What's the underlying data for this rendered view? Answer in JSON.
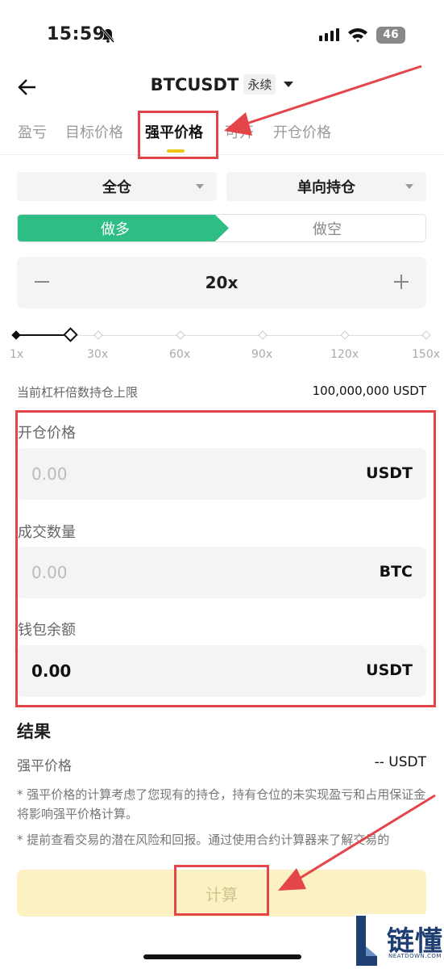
{
  "status_bar": {
    "time": "15:59",
    "battery": "46"
  },
  "header": {
    "title": "BTCUSDT",
    "badge": "永续"
  },
  "tabs": [
    {
      "label": "盈亏"
    },
    {
      "label": "目标价格"
    },
    {
      "label": "强平价格"
    },
    {
      "label": "可开"
    },
    {
      "label": "开仓价格"
    }
  ],
  "margin_mode": {
    "value": "全仓"
  },
  "position_mode": {
    "value": "单向持仓"
  },
  "direction": {
    "long": "做多",
    "short": "做空"
  },
  "leverage": {
    "value": "20x"
  },
  "slider": {
    "selected_fraction": 0.133,
    "ticks": [
      "1x",
      "30x",
      "60x",
      "90x",
      "120x",
      "150x"
    ]
  },
  "position_limit": {
    "label": "当前杠杆倍数持仓上限",
    "value": "100,000,000 USDT"
  },
  "fields": {
    "entry_price": {
      "label": "开仓价格",
      "value": "0.00",
      "unit": "USDT"
    },
    "quantity": {
      "label": "成交数量",
      "value": "0.00",
      "unit": "BTC"
    },
    "wallet_balance": {
      "label": "钱包余额",
      "value": "0.00",
      "unit": "USDT"
    }
  },
  "result": {
    "title": "结果",
    "liq_label": "强平价格",
    "liq_value": "-- USDT",
    "note1": "* 强平价格的计算考虑了您现有的持仓，持有仓位的未实现盈亏和占用保证金将影响强平价格计算。",
    "note2": "* 提前查看交易的潜在风险和回报。通过使用合约计算器来了解交易的"
  },
  "calc_button": {
    "label": "计算"
  },
  "watermark": {
    "text": "链懂",
    "sub": "NEATDOWN.COM"
  },
  "colors": {
    "long": "#2ebd85",
    "accent": "#f0c419",
    "annotation": "#e4454b"
  }
}
